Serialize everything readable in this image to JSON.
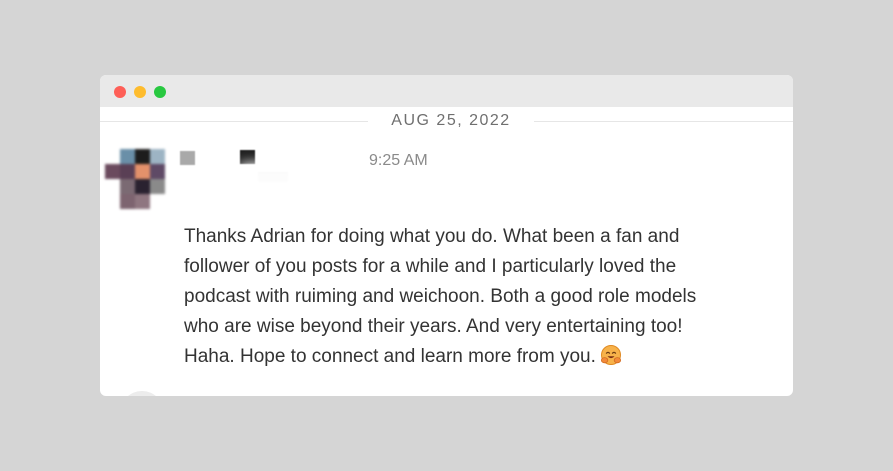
{
  "window": {
    "controls": [
      "close",
      "minimize",
      "maximize"
    ],
    "colors": {
      "close": "#fe5f57",
      "minimize": "#febc2e",
      "maximize": "#28c840"
    }
  },
  "date_divider": {
    "label": "AUG 25, 2022"
  },
  "message": {
    "author": "",
    "time": "9:25 AM",
    "text": "Thanks Adrian for doing what you do. What been a fan and follower of you posts for a while and I particularly loved the podcast with ruiming and weichoon. Both a good role models who are wise beyond their years. And very entertaining too! Haha. Hope to connect and learn more from you.",
    "emoji": "smiling-face-with-open-hands-icon",
    "avatar": "avatar (redacted)",
    "name_redacted": true
  }
}
